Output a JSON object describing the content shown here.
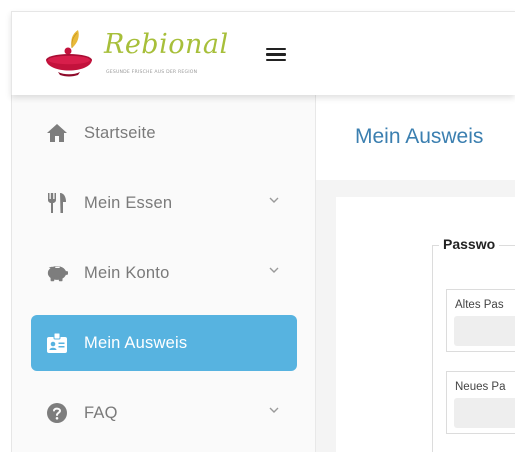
{
  "brand": {
    "name": "Rebional",
    "tagline": "GESUNDE FRISCHE AUS DER REGION",
    "colors": {
      "wordmark": "#a7bf3a",
      "bowl": "#c3123c",
      "leaf": "#e8b93a"
    }
  },
  "header": {
    "menu_icon": "hamburger-icon"
  },
  "sidebar": {
    "items": [
      {
        "label": "Startseite",
        "icon": "home-icon",
        "has_submenu": false,
        "active": false
      },
      {
        "label": "Mein Essen",
        "icon": "fork-knife-icon",
        "has_submenu": true,
        "active": false
      },
      {
        "label": "Mein Konto",
        "icon": "piggy-bank-icon",
        "has_submenu": true,
        "active": false
      },
      {
        "label": "Mein Ausweis",
        "icon": "id-badge-icon",
        "has_submenu": false,
        "active": true
      },
      {
        "label": "FAQ",
        "icon": "question-icon",
        "has_submenu": true,
        "active": false
      }
    ],
    "active_color": "#57b3e0"
  },
  "main": {
    "title": "Mein Ausweis",
    "form": {
      "legend": "Passwo",
      "fields": [
        {
          "label": "Altes Pas",
          "value": ""
        },
        {
          "label": "Neues Pa",
          "value": ""
        }
      ]
    }
  }
}
